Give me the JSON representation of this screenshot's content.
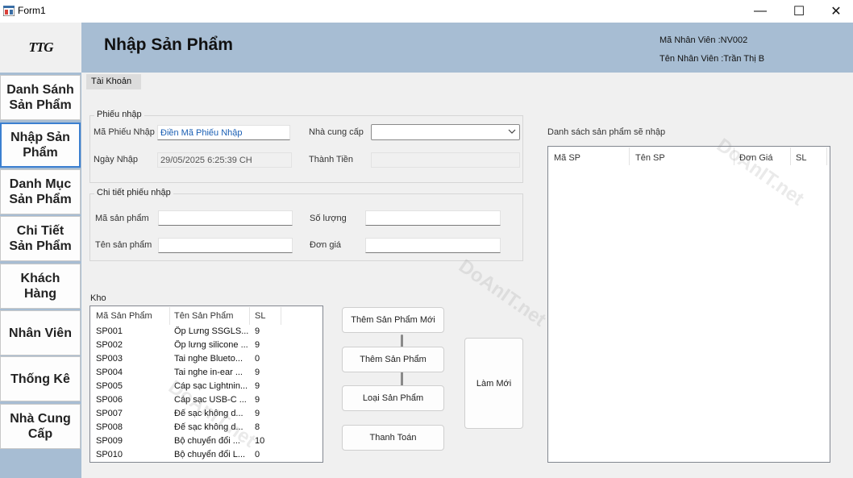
{
  "window": {
    "title": "Form1",
    "minimize": "—",
    "maximize": "☐",
    "close": "✕"
  },
  "logo": {
    "text": "TTG"
  },
  "nav": {
    "items": [
      {
        "label": "Danh Sánh\nSản Phẩm"
      },
      {
        "label": "Nhập Sản\nPhẩm"
      },
      {
        "label": "Danh Mục\nSản Phẩm"
      },
      {
        "label": "Chi Tiết\nSản Phẩm"
      },
      {
        "label": "Khách\nHàng"
      },
      {
        "label": "Nhân Viên"
      },
      {
        "label": "Thống Kê"
      },
      {
        "label": "Nhà Cung\nCấp"
      }
    ],
    "active_index": 1
  },
  "header": {
    "title": "Nhập Sản Phẩm",
    "employee_id": "Mã Nhân Viên :NV002",
    "employee_name": "Tên Nhân Viên :Trần Thị B",
    "tab": "Tài Khoản"
  },
  "receipt": {
    "group_label": "Phiếu nhập",
    "code_label": "Mã Phiếu Nhập",
    "code_placeholder": "Điền Mã Phiếu Nhập",
    "supplier_label": "Nhà cung cấp",
    "supplier_value": "",
    "date_label": "Ngày Nhập",
    "date_value": "29/05/2025 6:25:39 CH",
    "total_label": "Thành Tiền",
    "total_value": ""
  },
  "detail": {
    "group_label": "Chi tiết phiếu nhập",
    "product_code_label": "Mã sản phẩm",
    "product_code_value": "",
    "quantity_label": "Số lượng",
    "quantity_value": "",
    "product_name_label": "Tên sản phẩm",
    "product_name_value": "",
    "price_label": "Đơn giá",
    "price_value": ""
  },
  "stock": {
    "label": "Kho",
    "columns": [
      "Mã Sản Phẩm",
      "Tên Sản Phẩm",
      "SL"
    ],
    "rows": [
      {
        "code": "SP001",
        "name": "Ốp Lưng SSGLS...",
        "qty": "9"
      },
      {
        "code": "SP002",
        "name": "Ốp lưng silicone ...",
        "qty": "9"
      },
      {
        "code": "SP003",
        "name": "Tai nghe Blueto...",
        "qty": "0"
      },
      {
        "code": "SP004",
        "name": "Tai nghe in-ear ...",
        "qty": "9"
      },
      {
        "code": "SP005",
        "name": "Cáp sạc Lightnin...",
        "qty": "9"
      },
      {
        "code": "SP006",
        "name": "Cáp sạc USB-C ...",
        "qty": "9"
      },
      {
        "code": "SP007",
        "name": "Đế sạc không d...",
        "qty": "9"
      },
      {
        "code": "SP008",
        "name": "Đế sạc không d...",
        "qty": "8"
      },
      {
        "code": "SP009",
        "name": "Bộ chuyển đổi ...",
        "qty": "10"
      },
      {
        "code": "SP010",
        "name": "Bộ chuyển đổi L...",
        "qty": "0"
      }
    ]
  },
  "actions": {
    "add_new_product": "Thêm Sản Phẩm Mới",
    "add_product": "Thêm Sản Phẩm",
    "remove_product": "Loại Sản Phẩm",
    "checkout": "Thanh Toán",
    "refresh": "Làm Mới"
  },
  "import_list": {
    "label": "Danh sách sản phẩm sẽ nhập",
    "columns": [
      "Mã SP",
      "Tên SP",
      "Đơn Giá",
      "SL"
    ]
  },
  "watermark": {
    "text": "DoAnIT.net"
  }
}
